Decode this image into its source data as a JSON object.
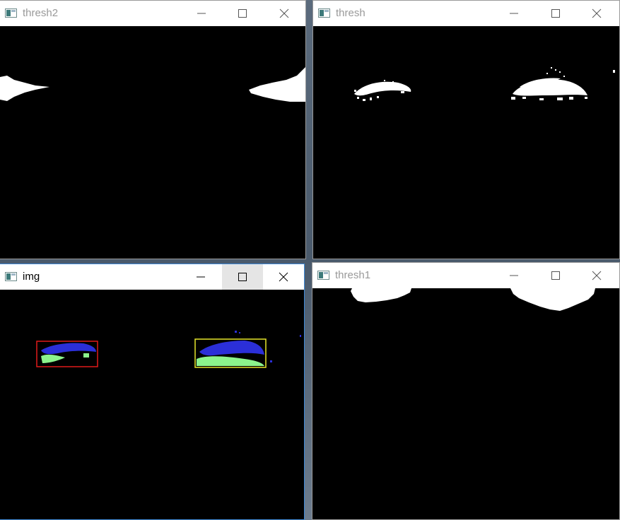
{
  "windows": {
    "thresh2": {
      "title": "thresh2",
      "active": false
    },
    "thresh": {
      "title": "thresh",
      "active": false
    },
    "img": {
      "title": "img",
      "active": true,
      "hovered_control": "maximize"
    },
    "thresh1": {
      "title": "thresh1",
      "active": false
    }
  },
  "controls": [
    "minimize",
    "maximize",
    "close"
  ],
  "colors": {
    "title_inactive": "#999999",
    "title_active": "#000000",
    "client_bg": "#000000",
    "mask_white": "#ffffff",
    "contour_blue": "#2b2fd8",
    "contour_green": "#8cf48c",
    "box_red": "#e11a1a",
    "box_yellow": "#e5e52a",
    "active_border": "#3f89d6"
  },
  "icons": {
    "window_icon": "opencv-window-icon",
    "minimize": "minimize-icon",
    "maximize": "maximize-icon",
    "close": "close-icon"
  }
}
